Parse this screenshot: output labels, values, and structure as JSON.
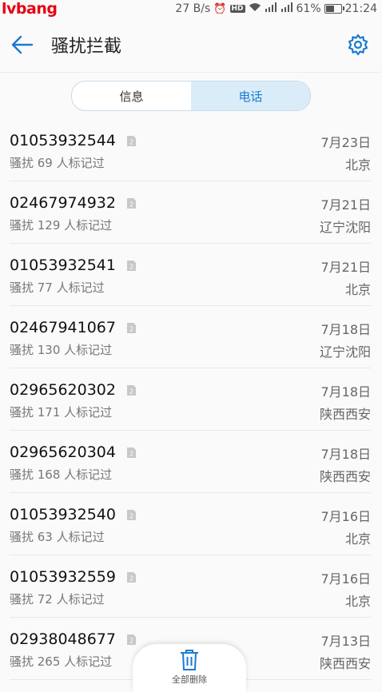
{
  "status": {
    "brand": "lvbang",
    "speed": "27 B/s",
    "net1": "3G",
    "net2": "4G",
    "battery": "61%",
    "battery_level": 0.61,
    "time": "21:24"
  },
  "header": {
    "title": "骚扰拦截",
    "icons": [
      "back-arrow-icon",
      "gear-icon"
    ],
    "accent": "#1b7bd0"
  },
  "tabs": [
    {
      "label": "信息",
      "active": false
    },
    {
      "label": "电话",
      "active": true
    }
  ],
  "calls": [
    {
      "number": "01053932544",
      "sub": "骚扰  69 人标记过",
      "date": "7月23日",
      "location": "北京",
      "sim": "2"
    },
    {
      "number": "02467974932",
      "sub": "骚扰  129 人标记过",
      "date": "7月21日",
      "location": "辽宁沈阳",
      "sim": "2"
    },
    {
      "number": "01053932541",
      "sub": "骚扰  77 人标记过",
      "date": "7月21日",
      "location": "北京",
      "sim": "2"
    },
    {
      "number": "02467941067",
      "sub": "骚扰  130 人标记过",
      "date": "7月18日",
      "location": "辽宁沈阳",
      "sim": "2"
    },
    {
      "number": "02965620302",
      "sub": "骚扰  171 人标记过",
      "date": "7月18日",
      "location": "陕西西安",
      "sim": "2"
    },
    {
      "number": "02965620304",
      "sub": "骚扰  168 人标记过",
      "date": "7月18日",
      "location": "陕西西安",
      "sim": "2"
    },
    {
      "number": "01053932540",
      "sub": "骚扰  63 人标记过",
      "date": "7月16日",
      "location": "北京",
      "sim": "2"
    },
    {
      "number": "01053932559",
      "sub": "骚扰  72 人标记过",
      "date": "7月16日",
      "location": "北京",
      "sim": "2"
    },
    {
      "number": "02938048677",
      "sub": "骚扰  265 人标记过",
      "date": "7月13日",
      "location": "陕西西安",
      "sim": "2"
    }
  ],
  "footer": {
    "delete_all_label": "全部删除"
  }
}
